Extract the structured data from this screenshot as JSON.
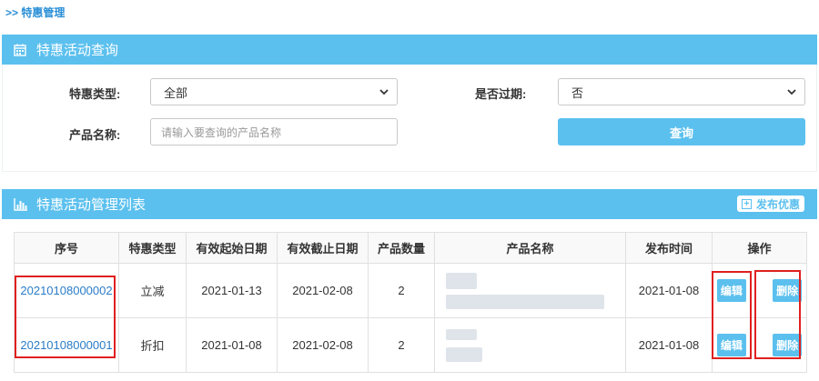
{
  "breadcrumb": ">> 特惠管理",
  "query_panel": {
    "title": "特惠活动查询",
    "type_label": "特惠类型:",
    "type_value": "全部",
    "expired_label": "是否过期:",
    "expired_value": "否",
    "product_label": "产品名称:",
    "product_placeholder": "请输入要查询的产品名称",
    "query_button": "查询"
  },
  "list_panel": {
    "title": "特惠活动管理列表",
    "publish_button": "发布优惠"
  },
  "table": {
    "headers": [
      "序号",
      "特惠类型",
      "有效起始日期",
      "有效截止日期",
      "产品数量",
      "产品名称",
      "发布时间",
      "操作"
    ],
    "rows": [
      {
        "id": "20210108000002",
        "type": "立减",
        "start": "2021-01-13",
        "end": "2021-02-08",
        "count": "2",
        "published": "2021-01-08",
        "edit": "编辑",
        "delete": "删除"
      },
      {
        "id": "20210108000001",
        "type": "折扣",
        "start": "2021-01-08",
        "end": "2021-02-08",
        "count": "2",
        "published": "2021-01-08",
        "edit": "编辑",
        "delete": "删除"
      }
    ]
  },
  "colors": {
    "accent": "#5bc0ee",
    "link": "#2a7cc7",
    "highlight": "#e02020"
  },
  "icons": [
    "calendar-icon",
    "chevron-down-icon",
    "bar-chart-icon",
    "plus-square-icon"
  ]
}
